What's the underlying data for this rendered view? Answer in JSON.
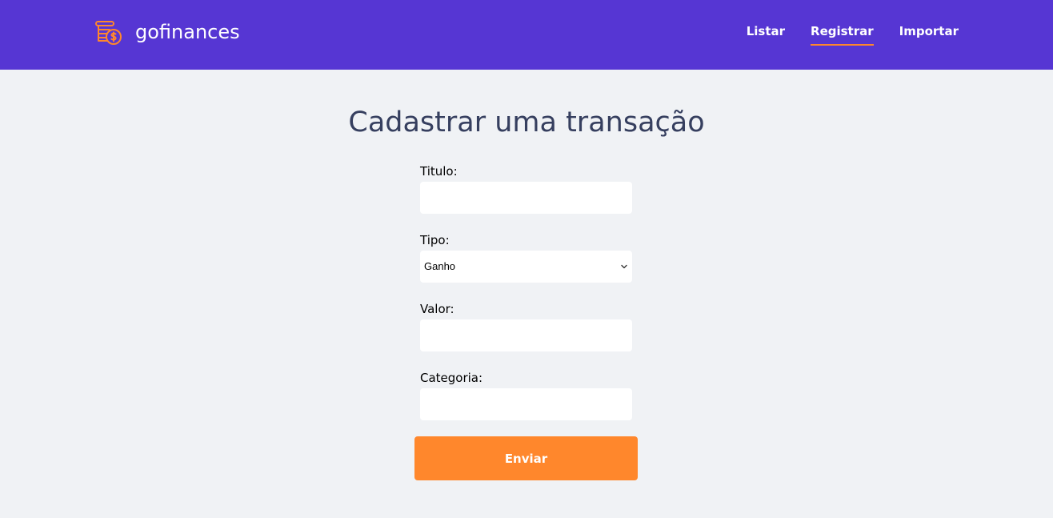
{
  "brand": {
    "name": "gofinances",
    "logo_icon": "coins-dollar-icon",
    "accent_color": "#FF872C",
    "header_color": "#5636D3"
  },
  "nav": {
    "items": [
      {
        "label": "Listar",
        "active": false
      },
      {
        "label": "Registrar",
        "active": true
      },
      {
        "label": "Importar",
        "active": false
      }
    ]
  },
  "page": {
    "title": "Cadastrar uma transação"
  },
  "form": {
    "titulo": {
      "label": "Titulo:",
      "value": "",
      "placeholder": ""
    },
    "tipo": {
      "label": "Tipo:",
      "selected": "Ganho"
    },
    "valor": {
      "label": "Valor:",
      "value": "",
      "placeholder": ""
    },
    "categoria": {
      "label": "Categoria:",
      "value": "",
      "placeholder": ""
    },
    "submit_label": "Enviar"
  }
}
